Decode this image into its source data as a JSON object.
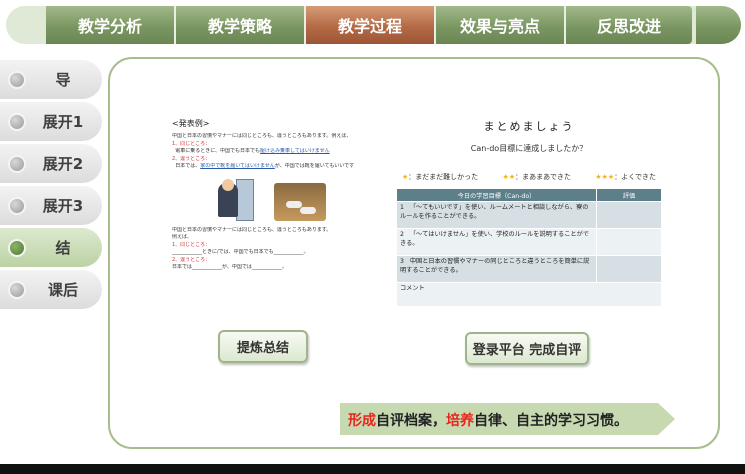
{
  "tabs": [
    "教学分析",
    "教学策略",
    "教学过程",
    "效果与亮点",
    "反思改进"
  ],
  "active_tab": 2,
  "sidebar": [
    "导",
    "展开1",
    "展开2",
    "展开3",
    "结",
    "课后"
  ],
  "active_side": 4,
  "doc": {
    "heading": "<発表例>",
    "intro": "中国と日本の習慣やマナーには同じところも、違うところもあります。例えば、",
    "same_label": "1、同じところ：",
    "same_text_a": "電車に乗るときに、中国でも日本でも",
    "same_text_b": "駆け込み乗車してはいけません",
    "diff_label": "2、違うところ：",
    "diff_text_a": "日本では、",
    "diff_text_b": "家の中で靴を履いてはいけません",
    "diff_text_c": "が、中国では靴を履いてもいいです",
    "intro2": "中国と日本の習慣やマナーには同じところも、違うところもあります。",
    "reiba": "例えば、",
    "blank_same_label": "1、同じところ：",
    "blank_same_text": "____________ときに/では、中国でも日本でも____________。",
    "blank_diff_label": "2、違うところ：",
    "blank_diff_text": "日本では____________が、中国では____________。"
  },
  "eval": {
    "title": "まとめましょう",
    "subtitle": "Can-do目標に達成しましたか？",
    "stars": [
      {
        "star": "★",
        "text": "：まだまだ難しかった"
      },
      {
        "star": "★★",
        "text": "：まあまあできた"
      },
      {
        "star": "★★★",
        "text": "：よくできた"
      }
    ],
    "table_headers": [
      "今日の学習目標（Can-do）",
      "評価"
    ],
    "rows": [
      {
        "no": "1",
        "text": "「～てもいいです」を使い、ルームメートと相談しながら、寮のルールを作ることができる。"
      },
      {
        "no": "2",
        "text": "「～てはいけません」を使い、学校のルールを説明することができる。"
      },
      {
        "no": "3",
        "text": "中国と日本の習慣やマナーの同じところと違うところを簡単に説明することができる。"
      }
    ],
    "comment_label": "コメント"
  },
  "buttons": {
    "summary": "提炼总结",
    "login": "登录平台 完成自评"
  },
  "banner": {
    "hl1": "形成",
    "t1": "自评档案，",
    "hl2": "培养",
    "t2": "自律、自主的学习习惯。"
  },
  "colors": {
    "tab_green": "#7a9762",
    "tab_active": "#b46a45",
    "banner_green": "#c7d9b1",
    "highlight_red": "#e8251b",
    "table_header": "#5c7f89"
  }
}
